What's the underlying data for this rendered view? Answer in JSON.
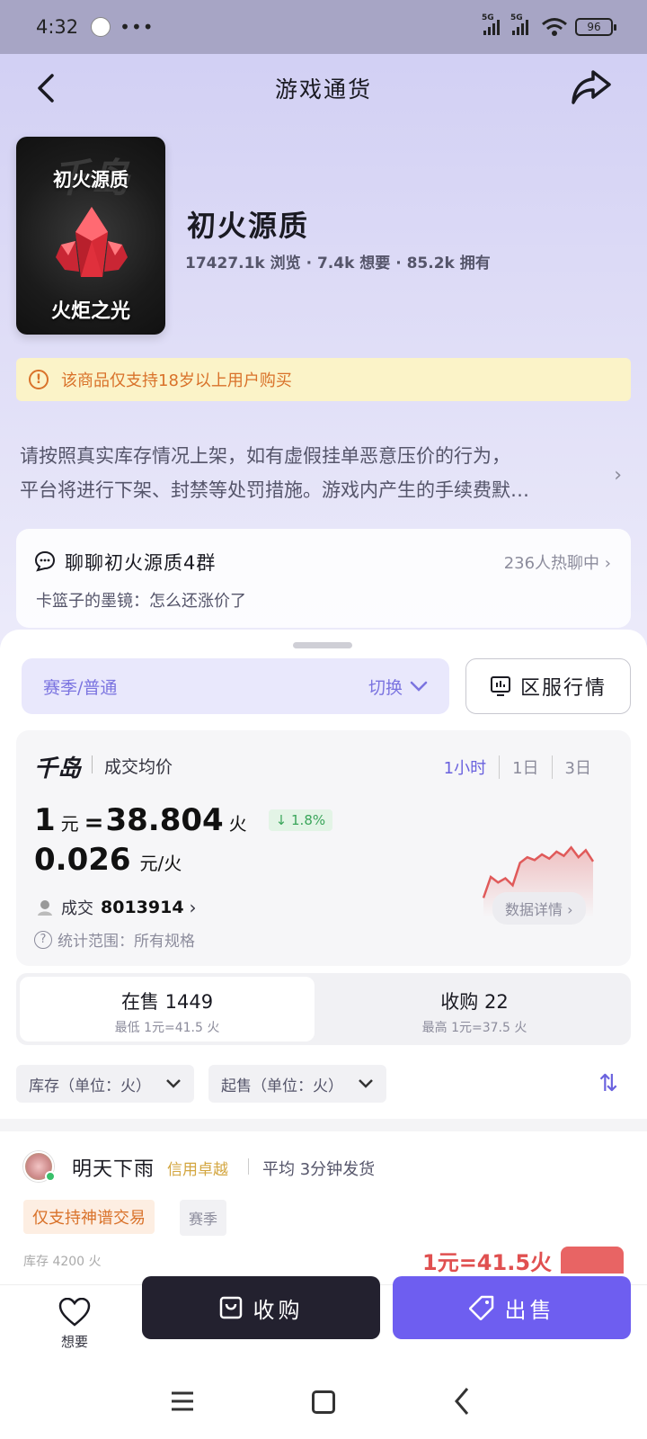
{
  "status": {
    "time": "4:32",
    "dots": "•••",
    "battery": "96",
    "network1": "5G",
    "network2": "5G"
  },
  "header": {
    "title": "游戏通货"
  },
  "product": {
    "image_top_text": "初火源质",
    "image_bottom_text": "火炬之光",
    "image_watermark": "千岛",
    "name": "初火源质",
    "stats": "17427.1k 浏览 · 7.4k 想要 · 85.2k 拥有"
  },
  "warning": {
    "icon": "!",
    "text": "该商品仅支持18岁以上用户购买"
  },
  "notice": {
    "line1": "请按照真实库存情况上架，如有虚假挂单恶意压价的行为，",
    "line2": "平台将进行下架、封禁等处罚措施。游戏内产生的手续费默…",
    "chevron": "›"
  },
  "chat": {
    "title": "聊聊初火源质4群",
    "count": "236人热聊中",
    "chevron": "›",
    "message": "卡篮子的墨镜：怎么还涨价了"
  },
  "filters_top": {
    "season": "赛季/普通",
    "switch": "切换",
    "server": "区服行情"
  },
  "price": {
    "logo": "千岛",
    "label": "成交均价",
    "ranges": [
      "1小时",
      "1日",
      "3日"
    ],
    "one": "1",
    "yuan": "元",
    "eq": "=",
    "rate": "38.804",
    "fire": "火",
    "change": "↓ 1.8%",
    "unit_price": "0.026",
    "unit_label": "元/火",
    "deal_label": "成交",
    "deal_count": "8013914",
    "deal_chevron": "›",
    "scope": "统计范围：所有规格",
    "detail": "数据详情 ›",
    "trend_color": "#e05a5a",
    "trend": [
      0.2,
      0.5,
      0.42,
      0.48,
      0.38,
      0.7,
      0.78,
      0.74,
      0.82,
      0.76,
      0.86,
      0.8,
      0.92,
      0.78,
      0.88,
      0.72
    ]
  },
  "trade": {
    "sell_tab": "在售 1449",
    "sell_sub": "最低 1元=41.5 火",
    "buy_tab": "收购 22",
    "buy_sub": "最高 1元=37.5 火"
  },
  "filters": {
    "stock": "库存（单位：火）",
    "min": "起售（单位：火）",
    "sort": "⇅"
  },
  "seller": {
    "name": "明天下雨",
    "credit": "信用卓越",
    "ship": "平均 3分钟发货",
    "tag1": "仅支持神谱交易",
    "tag2": "赛季",
    "peek_left": "库存 4200 火",
    "peek_right": "1元=41.5火"
  },
  "actions": {
    "want": "想要",
    "buy": "收购",
    "sell": "出售"
  },
  "colors": {
    "accent": "#6e5ef0",
    "warning": "#d9722a",
    "dark": "#23212f"
  }
}
